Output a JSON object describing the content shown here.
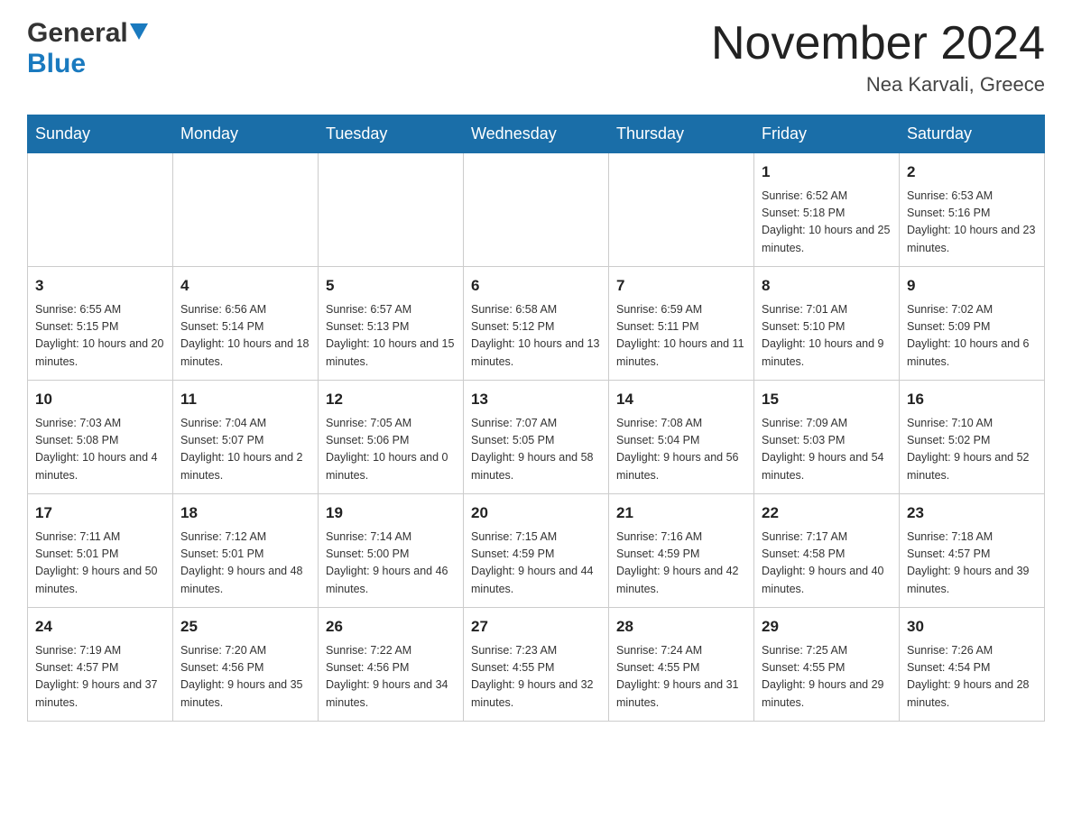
{
  "header": {
    "logo": {
      "general_text": "General",
      "blue_text": "Blue"
    },
    "month_title": "November 2024",
    "location": "Nea Karvali, Greece"
  },
  "calendar": {
    "days_of_week": [
      "Sunday",
      "Monday",
      "Tuesday",
      "Wednesday",
      "Thursday",
      "Friday",
      "Saturday"
    ],
    "weeks": [
      [
        {
          "day": "",
          "info": ""
        },
        {
          "day": "",
          "info": ""
        },
        {
          "day": "",
          "info": ""
        },
        {
          "day": "",
          "info": ""
        },
        {
          "day": "",
          "info": ""
        },
        {
          "day": "1",
          "info": "Sunrise: 6:52 AM\nSunset: 5:18 PM\nDaylight: 10 hours and 25 minutes."
        },
        {
          "day": "2",
          "info": "Sunrise: 6:53 AM\nSunset: 5:16 PM\nDaylight: 10 hours and 23 minutes."
        }
      ],
      [
        {
          "day": "3",
          "info": "Sunrise: 6:55 AM\nSunset: 5:15 PM\nDaylight: 10 hours and 20 minutes."
        },
        {
          "day": "4",
          "info": "Sunrise: 6:56 AM\nSunset: 5:14 PM\nDaylight: 10 hours and 18 minutes."
        },
        {
          "day": "5",
          "info": "Sunrise: 6:57 AM\nSunset: 5:13 PM\nDaylight: 10 hours and 15 minutes."
        },
        {
          "day": "6",
          "info": "Sunrise: 6:58 AM\nSunset: 5:12 PM\nDaylight: 10 hours and 13 minutes."
        },
        {
          "day": "7",
          "info": "Sunrise: 6:59 AM\nSunset: 5:11 PM\nDaylight: 10 hours and 11 minutes."
        },
        {
          "day": "8",
          "info": "Sunrise: 7:01 AM\nSunset: 5:10 PM\nDaylight: 10 hours and 9 minutes."
        },
        {
          "day": "9",
          "info": "Sunrise: 7:02 AM\nSunset: 5:09 PM\nDaylight: 10 hours and 6 minutes."
        }
      ],
      [
        {
          "day": "10",
          "info": "Sunrise: 7:03 AM\nSunset: 5:08 PM\nDaylight: 10 hours and 4 minutes."
        },
        {
          "day": "11",
          "info": "Sunrise: 7:04 AM\nSunset: 5:07 PM\nDaylight: 10 hours and 2 minutes."
        },
        {
          "day": "12",
          "info": "Sunrise: 7:05 AM\nSunset: 5:06 PM\nDaylight: 10 hours and 0 minutes."
        },
        {
          "day": "13",
          "info": "Sunrise: 7:07 AM\nSunset: 5:05 PM\nDaylight: 9 hours and 58 minutes."
        },
        {
          "day": "14",
          "info": "Sunrise: 7:08 AM\nSunset: 5:04 PM\nDaylight: 9 hours and 56 minutes."
        },
        {
          "day": "15",
          "info": "Sunrise: 7:09 AM\nSunset: 5:03 PM\nDaylight: 9 hours and 54 minutes."
        },
        {
          "day": "16",
          "info": "Sunrise: 7:10 AM\nSunset: 5:02 PM\nDaylight: 9 hours and 52 minutes."
        }
      ],
      [
        {
          "day": "17",
          "info": "Sunrise: 7:11 AM\nSunset: 5:01 PM\nDaylight: 9 hours and 50 minutes."
        },
        {
          "day": "18",
          "info": "Sunrise: 7:12 AM\nSunset: 5:01 PM\nDaylight: 9 hours and 48 minutes."
        },
        {
          "day": "19",
          "info": "Sunrise: 7:14 AM\nSunset: 5:00 PM\nDaylight: 9 hours and 46 minutes."
        },
        {
          "day": "20",
          "info": "Sunrise: 7:15 AM\nSunset: 4:59 PM\nDaylight: 9 hours and 44 minutes."
        },
        {
          "day": "21",
          "info": "Sunrise: 7:16 AM\nSunset: 4:59 PM\nDaylight: 9 hours and 42 minutes."
        },
        {
          "day": "22",
          "info": "Sunrise: 7:17 AM\nSunset: 4:58 PM\nDaylight: 9 hours and 40 minutes."
        },
        {
          "day": "23",
          "info": "Sunrise: 7:18 AM\nSunset: 4:57 PM\nDaylight: 9 hours and 39 minutes."
        }
      ],
      [
        {
          "day": "24",
          "info": "Sunrise: 7:19 AM\nSunset: 4:57 PM\nDaylight: 9 hours and 37 minutes."
        },
        {
          "day": "25",
          "info": "Sunrise: 7:20 AM\nSunset: 4:56 PM\nDaylight: 9 hours and 35 minutes."
        },
        {
          "day": "26",
          "info": "Sunrise: 7:22 AM\nSunset: 4:56 PM\nDaylight: 9 hours and 34 minutes."
        },
        {
          "day": "27",
          "info": "Sunrise: 7:23 AM\nSunset: 4:55 PM\nDaylight: 9 hours and 32 minutes."
        },
        {
          "day": "28",
          "info": "Sunrise: 7:24 AM\nSunset: 4:55 PM\nDaylight: 9 hours and 31 minutes."
        },
        {
          "day": "29",
          "info": "Sunrise: 7:25 AM\nSunset: 4:55 PM\nDaylight: 9 hours and 29 minutes."
        },
        {
          "day": "30",
          "info": "Sunrise: 7:26 AM\nSunset: 4:54 PM\nDaylight: 9 hours and 28 minutes."
        }
      ]
    ]
  }
}
